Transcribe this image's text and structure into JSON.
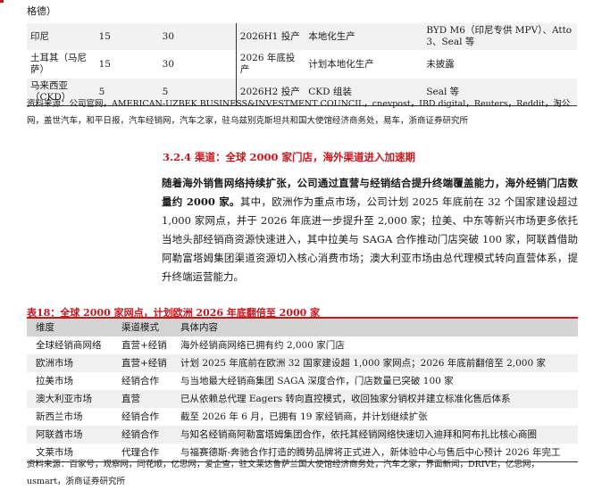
{
  "top_fragment": "格德）",
  "table1": {
    "rows": [
      [
        "印尼",
        "15",
        "30",
        "2026H1 投产",
        "本地化生产",
        "BYD M6（印尼专供 MPV）、Atto 3、Seal 等"
      ],
      [
        "土耳其（马尼萨）",
        "15",
        "30",
        "2026 年底投产",
        "计划本地化生产",
        "未披露"
      ],
      [
        "马来西亚（CKD）",
        "5",
        "5",
        "2026H2 投产",
        "CKD 组装",
        "Seal 等"
      ]
    ]
  },
  "source1": "资料来源：公司官网，AMERICAN-UZBEK BUSINESS&INVESTMENT COUNCIL，cnevpost，IBD digital，Reuters，Reddit，淘公网，盖世汽车，和平日报，汽车经销网，汽车之家，驻乌兹别克斯坦共和国大使馆经济商务处，易车，浙商证券研究所",
  "section_title": "3.2.4 渠道：全球 2000 家门店，海外渠道进入加速期",
  "paragraph_bold": "随着海外销售网络持续扩张，公司通过直营与经销结合提升终端覆盖能力，海外经销门店数量约 2000 家。",
  "paragraph_rest": "其中，欧洲作为重点市场，公司计划 2025 年底前在 32 个国家建设超过 1,000 家网点，并于 2026 年底进一步提升至 2,000 家；拉美、中东等新兴市场更多依托当地头部经销商资源快速进入，其中拉美与 SAGA 合作推动门店突破 100 家，阿联酋借助阿勒富塔姆集团渠道资源切入核心消费市场；澳大利亚市场由总代理模式转向直营体系，提升终端运营能力。",
  "table2": {
    "caption": "表18：全球 2000 家网点，计划欧洲 2026 年底翻倍至 2000 家",
    "headers": [
      "维度",
      "渠道模式",
      "具体内容"
    ],
    "rows": [
      [
        "全球经销商网络",
        "直营+经销",
        "海外经销商网络已拥有约 2,000 家门店"
      ],
      [
        "欧洲市场",
        "直营+经销",
        "计划 2025 年底前在欧洲 32 国家建设超 1,000 家网点；2026 年底前翻倍至 2,000 家"
      ],
      [
        "拉美市场",
        "经销合作",
        "与当地最大经销商集团 SAGA 深度合作，门店数量已突破 100 家"
      ],
      [
        "澳大利亚市场",
        "直营",
        "已从依赖总代理 Eagers 转向直控模式，收回独家分销权并建立标准化售后体系"
      ],
      [
        "新西兰市场",
        "经销合作",
        "截至 2026 年 6 月，已拥有 19 家经销商，并计划继续扩张"
      ],
      [
        "阿联酋市场",
        "经销合作",
        "与知名经销商阿勒富塔姆集团合作，依托其经销网络快速切入迪拜和阿布扎比核心商圈"
      ],
      [
        "文莱市场",
        "代理合作",
        "与福赛德斯-奔驰合作打造的腾势品牌将正式进入，新体验中心与售后中心预计 2026 年完工"
      ]
    ]
  },
  "source2": "资料来源：百家号，观察网，同花顺，亿思网，爱企查，驻文莱达鲁萨兰国大使馆经济商务处，汽车之家，界面新闻，DRIVE，亿思网，usmart，浙商证券研究所",
  "colors": {
    "accent": "#c8161d",
    "header_bg": "#d4d4d4",
    "stripe_bg": "#f0f0f0"
  }
}
